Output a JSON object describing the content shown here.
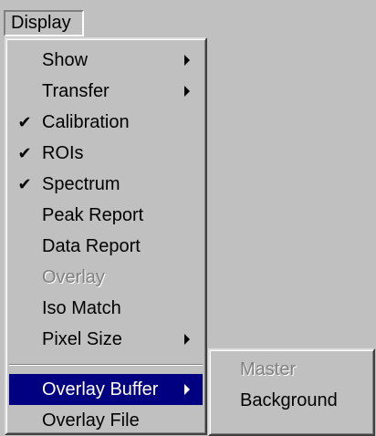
{
  "menubar": {
    "display_label": "Display"
  },
  "display_menu": {
    "items": [
      {
        "label": "Show",
        "checked": false,
        "submenu": true,
        "disabled": false
      },
      {
        "label": "Transfer",
        "checked": false,
        "submenu": true,
        "disabled": false
      },
      {
        "label": "Calibration",
        "checked": true,
        "submenu": false,
        "disabled": false
      },
      {
        "label": "ROIs",
        "checked": true,
        "submenu": false,
        "disabled": false
      },
      {
        "label": "Spectrum",
        "checked": true,
        "submenu": false,
        "disabled": false
      },
      {
        "label": "Peak Report",
        "checked": false,
        "submenu": false,
        "disabled": false
      },
      {
        "label": "Data Report",
        "checked": false,
        "submenu": false,
        "disabled": false
      },
      {
        "label": "Overlay",
        "checked": false,
        "submenu": false,
        "disabled": true
      },
      {
        "label": "Iso Match",
        "checked": false,
        "submenu": false,
        "disabled": false
      },
      {
        "label": "Pixel Size",
        "checked": false,
        "submenu": true,
        "disabled": false
      },
      {
        "label": "Overlay Buffer",
        "checked": false,
        "submenu": true,
        "disabled": false,
        "highlighted": true
      },
      {
        "label": "Overlay File",
        "checked": false,
        "submenu": false,
        "disabled": false
      }
    ],
    "check_glyph": "✔"
  },
  "overlay_buffer_submenu": {
    "items": [
      {
        "label": "Master",
        "disabled": true
      },
      {
        "label": "Background",
        "disabled": false
      }
    ]
  },
  "colors": {
    "menu_face": "#c0c0c0",
    "highlight": "#000080",
    "disabled_text": "#808080"
  }
}
